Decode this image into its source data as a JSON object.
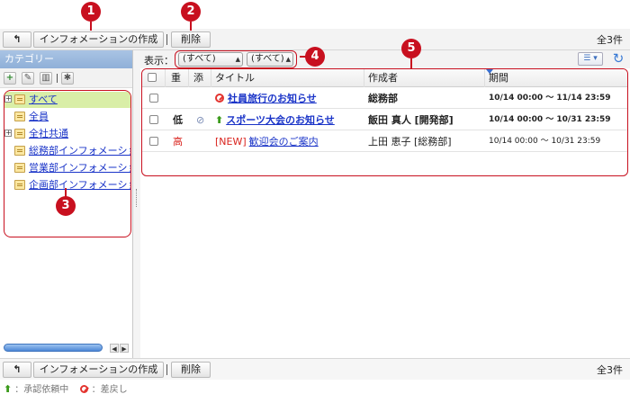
{
  "toolbar": {
    "back_icon": "back-arrow-icon",
    "create_label": "インフォメーションの作成",
    "delete_label": "削除",
    "count": "全3件"
  },
  "callouts": [
    "1",
    "2",
    "3",
    "4",
    "5"
  ],
  "sidebar": {
    "title": "カテゴリー",
    "tools": [
      "add-icon",
      "edit-icon",
      "trash-icon",
      "settings-icon"
    ],
    "items": [
      {
        "label": "すべて",
        "expandable": true,
        "selected": true
      },
      {
        "label": "全員",
        "expandable": false,
        "selected": false
      },
      {
        "label": "全社共通",
        "expandable": true,
        "selected": false
      },
      {
        "label": "総務部インフォメーション",
        "expandable": false,
        "selected": false
      },
      {
        "label": "営業部インフォメーション",
        "expandable": false,
        "selected": false
      },
      {
        "label": "企画部インフォメーション",
        "expandable": false,
        "selected": false
      }
    ]
  },
  "filter": {
    "label": "表示：",
    "select1": "(すべて)",
    "select2": "(すべて)"
  },
  "table": {
    "headers": [
      "重",
      "添",
      "タイトル",
      "作成者",
      "期間"
    ],
    "rows": [
      {
        "priority": "",
        "attach": false,
        "icon": "deny",
        "title": "社員旅行のお知らせ",
        "author": "総務部",
        "period": "10/14 00:00 〜 11/14 23:59",
        "bold": true,
        "new": false
      },
      {
        "priority": "低",
        "attach": true,
        "icon": "up",
        "title": "スポーツ大会のお知らせ",
        "author": "飯田 真人 [開発部]",
        "period": "10/14 00:00 〜 10/31 23:59",
        "bold": true,
        "new": false
      },
      {
        "priority": "高",
        "attach": false,
        "icon": "",
        "title": "歓迎会のご案内",
        "author": "上田 恵子 [総務部]",
        "period": "10/14 00:00 〜 10/31 23:59",
        "bold": false,
        "new": true
      }
    ],
    "new_tag": "[NEW]"
  },
  "legend": {
    "pending": "：承認依頼中",
    "rejected": "：差戻し"
  },
  "colors": {
    "callout": "#c8101f",
    "link": "#1a34c8",
    "selected_row": "#d9eea7",
    "header_blue": "#8fb0d8"
  }
}
